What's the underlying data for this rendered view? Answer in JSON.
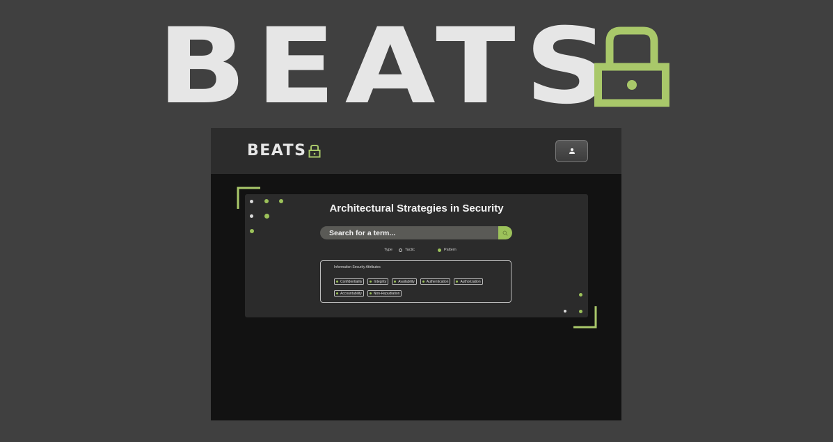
{
  "hero": {
    "word": "BEATS",
    "icon": "lock-icon"
  },
  "app": {
    "brand": "BEATS",
    "brand_icon": "lock-icon",
    "profile_icon": "user-icon"
  },
  "main": {
    "title": "Architectural Strategies in Security",
    "search": {
      "placeholder": "Search for a term...",
      "value": "",
      "button_icon": "search-icon"
    },
    "type_filter": {
      "label": "Type",
      "options": [
        {
          "label": "Tactic",
          "selected": false
        },
        {
          "label": "Pattern",
          "selected": true
        }
      ]
    },
    "attributes": {
      "title": "Information Security Attributes",
      "items": [
        "Confidentiality",
        "Integrity",
        "Availability",
        "Authentication",
        "Authorization",
        "Accountability",
        "Non-Repudiation"
      ]
    }
  },
  "colors": {
    "accent": "#9cc25a",
    "background": "#404040",
    "app_bg": "#121212",
    "topbar": "#2c2c2c",
    "card": "#2b2b2b",
    "text_light": "#e6e6e6"
  }
}
